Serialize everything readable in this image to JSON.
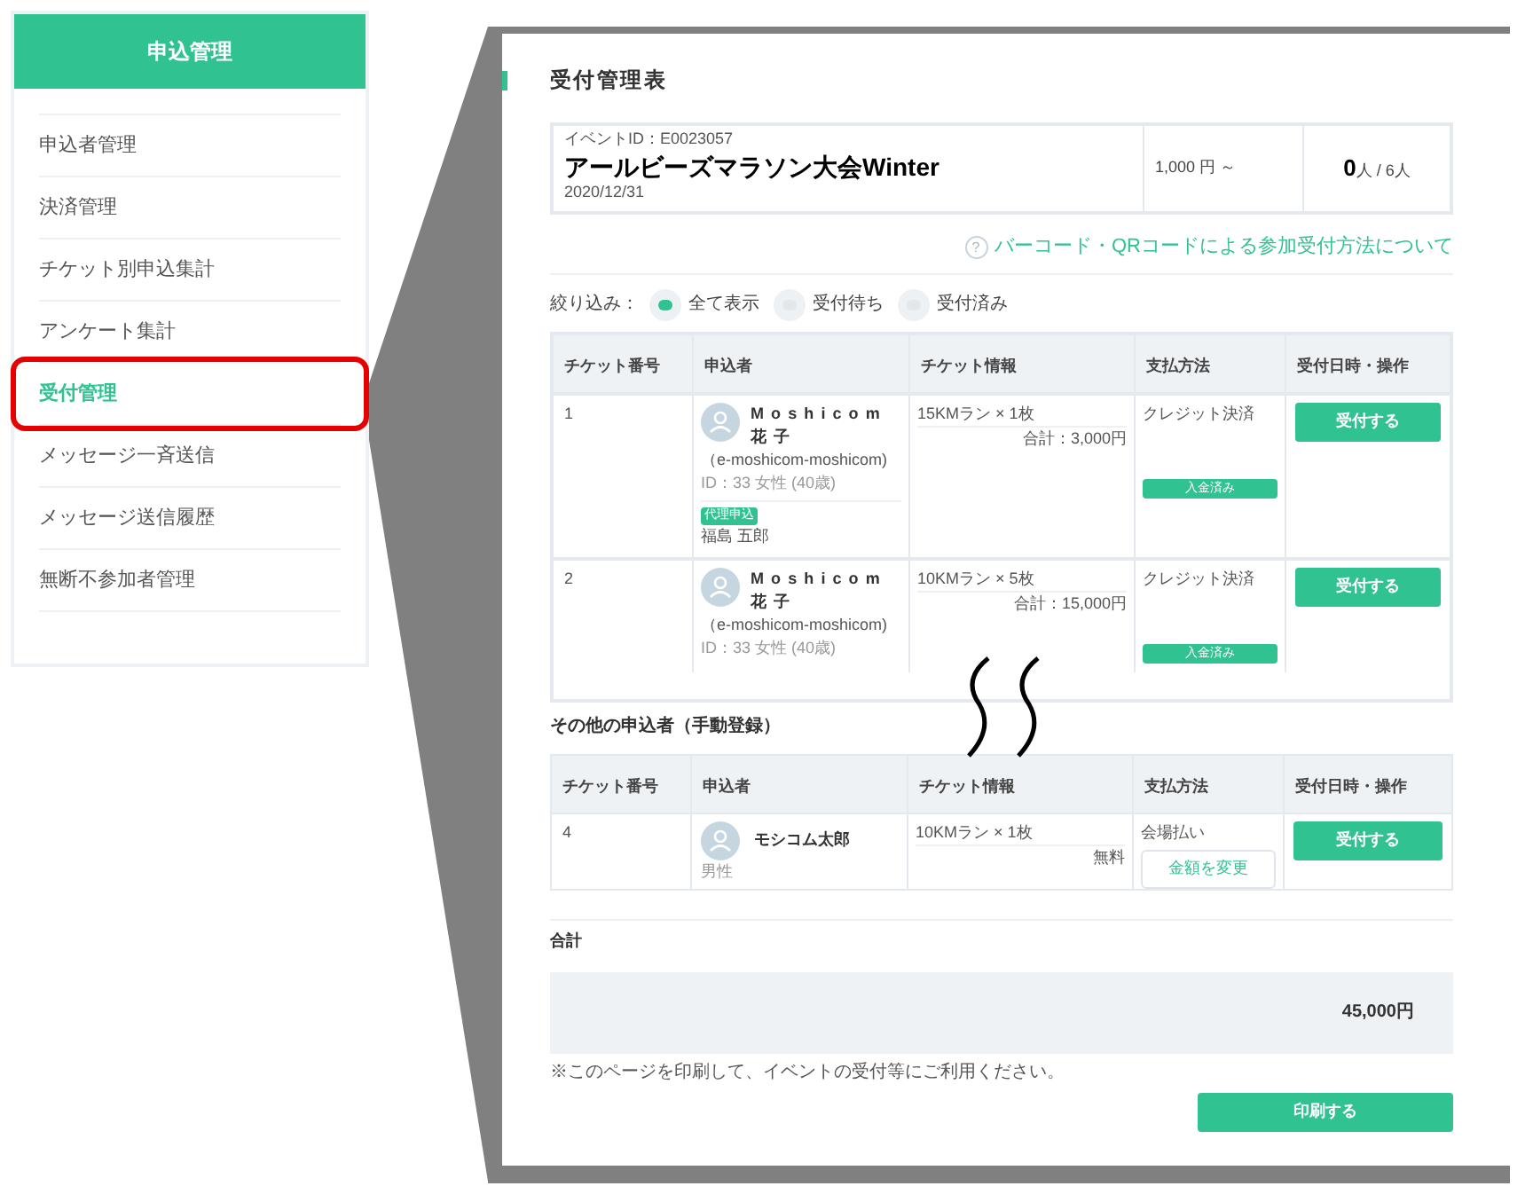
{
  "sidebar": {
    "header": "申込管理",
    "items": [
      {
        "label": "申込者管理",
        "selected": false
      },
      {
        "label": "決済管理",
        "selected": false
      },
      {
        "label": "チケット別申込集計",
        "selected": false
      },
      {
        "label": "アンケート集計",
        "selected": false
      },
      {
        "label": "受付管理",
        "selected": true
      },
      {
        "label": "メッセージ一斉送信",
        "selected": false
      },
      {
        "label": "メッセージ送信履歴",
        "selected": false
      },
      {
        "label": "無断不参加者管理",
        "selected": false
      }
    ]
  },
  "panel": {
    "title": "受付管理表",
    "event": {
      "id": "イベントID：E0023057",
      "name": "アールビーズマラソン大会Winter",
      "date": "2020/12/31",
      "price": "1,000 円 ～",
      "count": "0",
      "count_suffix": "人 / 6人"
    },
    "help_icon": "?",
    "help_link": "バーコード・QRコードによる参加受付方法について",
    "filter": {
      "label": "絞り込み：",
      "options": [
        {
          "label": "全て表示",
          "selected": true
        },
        {
          "label": "受付待ち",
          "selected": false
        },
        {
          "label": "受付済み",
          "selected": false
        }
      ]
    },
    "table": {
      "columns": [
        "チケット番号",
        "申込者",
        "チケット情報",
        "支払方法",
        "受付日時・操作"
      ],
      "rows": [
        {
          "number": "1",
          "name": "Moshicom 花子",
          "email": "（e-moshicom-moshicom)",
          "info": "ID：33 女性 (40歳)",
          "proxy_badge": "代理申込",
          "proxy_name": "福島 五郎",
          "ticket": "15KMラン × 1枚",
          "total": "合計：3,000円",
          "payment": "クレジット決済",
          "payment_badge": "入金済み",
          "action": "受付する"
        },
        {
          "number": "2",
          "name": "Moshicom 花子",
          "email": "（e-moshicom-moshicom)",
          "info": "ID：33 女性 (40歳)",
          "ticket": "10KMラン × 5枚",
          "total": "合計：15,000円",
          "payment": "クレジット決済",
          "payment_badge": "入金済み",
          "action": "受付する"
        }
      ]
    },
    "manual": {
      "title": "その他の申込者（手動登録）",
      "columns": [
        "チケット番号",
        "申込者",
        "チケット情報",
        "支払方法",
        "受付日時・操作"
      ],
      "rows": [
        {
          "number": "4",
          "name": "モシコム太郎",
          "gender": "男性",
          "ticket": "10KMラン × 1枚",
          "total": "無料",
          "payment": "会場払い",
          "change_button": "金額を変更",
          "action": "受付する"
        }
      ]
    },
    "summary": {
      "label": "合計",
      "amount": "45,000円"
    },
    "note": "※このページを印刷して、イベントの受付等にご利用ください。",
    "print_button": "印刷する"
  }
}
